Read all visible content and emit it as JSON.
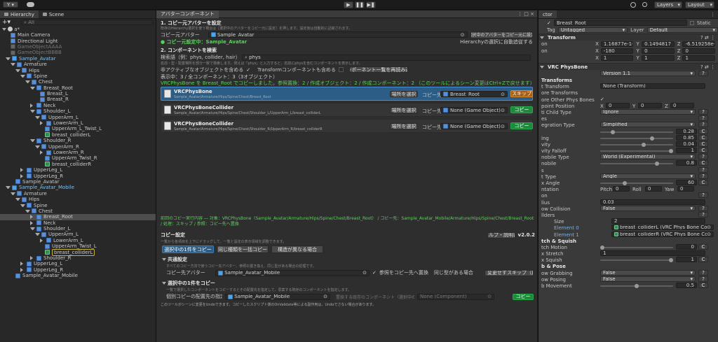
{
  "toolbar": {
    "account": "Y",
    "layers": "Layers",
    "layout": "Layout"
  },
  "hierarchy": {
    "tab": "Hierarchy",
    "scene_tab": "Scene",
    "search": "All",
    "scene": "a*",
    "items": [
      {
        "label": "Main Camera",
        "indent": 2,
        "icon": "cube",
        "exp": ""
      },
      {
        "label": "Directional Light",
        "indent": 2,
        "icon": "cube",
        "exp": ""
      },
      {
        "label": "GameObjectAAAA",
        "indent": 2,
        "icon": "grey",
        "exp": ""
      },
      {
        "label": "GameObjectBBBB",
        "indent": 2,
        "icon": "grey",
        "exp": ""
      },
      {
        "label": "Sample_Avatar",
        "indent": 2,
        "icon": "blue",
        "exp": "d"
      },
      {
        "label": "Armature",
        "indent": 3,
        "icon": "cube",
        "exp": "d"
      },
      {
        "label": "Hips",
        "indent": 4,
        "icon": "cube",
        "exp": "d"
      },
      {
        "label": "Spine",
        "indent": 5,
        "icon": "cube",
        "exp": "d"
      },
      {
        "label": "Chest",
        "indent": 6,
        "icon": "cube",
        "exp": "d"
      },
      {
        "label": "Breast_Root",
        "indent": 7,
        "icon": "cube",
        "exp": "d"
      },
      {
        "label": "Breast_L",
        "indent": 8,
        "icon": "cube",
        "exp": ""
      },
      {
        "label": "Breast_R",
        "indent": 8,
        "icon": "cube",
        "exp": ""
      },
      {
        "label": "Neck",
        "indent": 7,
        "icon": "cube",
        "exp": "r"
      },
      {
        "label": "Shoulder_L",
        "indent": 7,
        "icon": "cube",
        "exp": "d"
      },
      {
        "label": "UpperArm_L",
        "indent": 8,
        "icon": "cube",
        "exp": "d"
      },
      {
        "label": "LowerArm_L",
        "indent": 9,
        "icon": "cube",
        "exp": "r"
      },
      {
        "label": "UpperArm_L_Twist_L",
        "indent": 9,
        "icon": "cube",
        "exp": ""
      },
      {
        "label": "breast_colliderL",
        "indent": 9,
        "icon": "green",
        "exp": ""
      },
      {
        "label": "Shoulder_R",
        "indent": 7,
        "icon": "cube",
        "exp": "d"
      },
      {
        "label": "UpperArm_R",
        "indent": 8,
        "icon": "cube",
        "exp": "d"
      },
      {
        "label": "LowerArm_R",
        "indent": 9,
        "icon": "cube",
        "exp": "r"
      },
      {
        "label": "UpperArm_Twist_R",
        "indent": 9,
        "icon": "cube",
        "exp": ""
      },
      {
        "label": "breast_colliderR",
        "indent": 9,
        "icon": "green",
        "exp": ""
      },
      {
        "label": "UpperLeg_L",
        "indent": 5,
        "icon": "cube",
        "exp": "r"
      },
      {
        "label": "UpperLeg_R",
        "indent": 5,
        "icon": "cube",
        "exp": "r"
      },
      {
        "label": "Sample_Avatar",
        "indent": 3,
        "icon": "cube",
        "exp": ""
      },
      {
        "label": "Sample_Avatar_Mobile",
        "indent": 2,
        "icon": "blue",
        "exp": "d"
      },
      {
        "label": "Armature",
        "indent": 3,
        "icon": "cube",
        "exp": "d"
      },
      {
        "label": "Hips",
        "indent": 4,
        "icon": "cube",
        "exp": "d"
      },
      {
        "label": "Spine",
        "indent": 5,
        "icon": "cube",
        "exp": "d"
      },
      {
        "label": "Chest",
        "indent": 6,
        "icon": "cube",
        "exp": "d"
      },
      {
        "label": "Breast_Root",
        "indent": 7,
        "icon": "cube",
        "exp": "r",
        "sel": true
      },
      {
        "label": "Neck",
        "indent": 7,
        "icon": "cube",
        "exp": "r"
      },
      {
        "label": "Shoulder_L",
        "indent": 7,
        "icon": "cube",
        "exp": "d"
      },
      {
        "label": "UpperArm_L",
        "indent": 8,
        "icon": "cube",
        "exp": "d"
      },
      {
        "label": "LowerArm_L",
        "indent": 9,
        "icon": "cube",
        "exp": "r"
      },
      {
        "label": "UpperArm_Twist_L",
        "indent": 9,
        "icon": "cube",
        "exp": ""
      },
      {
        "label": "breast_colliderL",
        "indent": 9,
        "icon": "green",
        "exp": "",
        "hl": true
      },
      {
        "label": "Shoulder_R",
        "indent": 7,
        "icon": "cube",
        "exp": "r"
      },
      {
        "label": "UpperLeg_L",
        "indent": 5,
        "icon": "cube",
        "exp": "r"
      },
      {
        "label": "UpperLeg_R",
        "indent": 5,
        "icon": "cube",
        "exp": "r"
      },
      {
        "label": "Sample_Avatar_Mobile",
        "indent": 3,
        "icon": "cube",
        "exp": ""
      }
    ]
  },
  "window": {
    "title": "アバターコンポーネント",
    "s1_title": "1. コピー元アバターを設定",
    "s1_note": "既存のHierarchy選択を使う場合は［選択中のアバターをコピー元に設定］を押します。設定後は自動的に記録されます。",
    "src_label": "コピー元アバター",
    "src_value": "Sample_Avatar",
    "src_btn": "選択中のアバターをコピー元に設定",
    "src_status": "● コピー元設定中：Sample_Avatar",
    "src_auto": "Hierarchyの選択に自動追従する",
    "s2_title": "2. コンポーネントを検索",
    "search_label": "検索語（例：phys, collider, hair）",
    "search_value": "phys",
    "search_note": "名前・型・配置場所を部分一致で検索します。例えば「phys」と入力すると、名前にphysを含むコンポーネントを表示します。",
    "opt_inactive": "非アクティブなオブジェクトを含める",
    "opt_transform": "Transformコンポーネントも含める",
    "rescan_btn": "コンポーネント一覧を再読み込み",
    "count": "表示中：3 / 全コンポーネント：3（3オブジェクト）",
    "green_status": "VRCPhysBone を Breast_Root でコピーしました。参照置換：2 / 作成オブジェクト：2 / 作成コンポーネント：2 （このツールによるシーン変更はCtrl+Zで戻せます）",
    "comps": [
      {
        "name": "VRCPhysBone",
        "path": "Sample_Avatar/Armature/Hips/Spine/Chest/Breast_Root",
        "target": "Breast_Root",
        "action": "スキップ",
        "sel": true
      },
      {
        "name": "VRCPhysBoneCollider",
        "path": "Sample_Avatar/Armature/Hips/Spine/Chest/Shoulder_L/UpperArm_L/breast_colliderL",
        "target": "None (Game Object)",
        "action": "コピー"
      },
      {
        "name": "VRCPhysBoneCollider",
        "path": "Sample_Avatar/Armature/Hips/Spine/Chest/Shoulder_R/UpperArm_R/breast_colliderR",
        "target": "None (Game Object)",
        "action": "コピー"
      }
    ],
    "select_place": "場所を選択",
    "copy_dest": "コピー先",
    "bottom_status": "前回のコピー実行内容 ― 対象：VRCPhysBone（Sample_Avatar/Armature/Hips/Spine/Chest/Breast_Root） / コピー先：Sample_Avatar_Mobile/Armature/Hips/Spine/Chest/Breast_Root / 処理：スキップ / 参照：コピー先へ置換",
    "copy_settings": "コピー設定",
    "help_btn": "ヘルプ・説明書",
    "version": "v2.0.2",
    "copy_note": "一覧から各項目を上下にドラッグして、一覧と設定の表示領域を調整できます。",
    "tabs": [
      "選択中の1件をコピー",
      "同じ種類を一括コピー",
      "構造が異なる場合"
    ],
    "common": "共通設定",
    "common_note": "すべてのコピー方法で使うコピー先アバター、参照の置き換え、同じ型がある場合の処理です。",
    "dest_label": "コピー先アバター",
    "dest_value": "Sample_Avatar_Mobile",
    "ref_replace": "参照をコピー先へ置換",
    "same_type": "同じ型がある場合",
    "same_sel": "変更せずスキップ（推奨）",
    "single": "選択中の1件をコピー",
    "single_note": "一覧で選択したコンポーネントをコピーするとその配置先を指定して、思案する既存のコンポーネントを指定します。",
    "single_label": "個別コピーの配置先の指定先",
    "single_value": "Sample_Avatar_Mobile",
    "single_hint": "置換する既存のコンポーネント（選択中の1件）",
    "single_none": "None (Component)",
    "copy_btn": "コピー",
    "footer": "このツールがシーンに変更をUndoできます。コピーしたスクリプト側のOnValidate等による副作用は、Undoでさない場合があります。"
  },
  "inspector": {
    "tab": "ctor",
    "name": "Breast_Root",
    "static": "Static",
    "tag_label": "Tag",
    "tag": "Untagged",
    "layer_label": "Layer",
    "layer": "Default",
    "transform": "Transform",
    "pos": [
      "1.16877e-16",
      "0.1494817",
      "-6.519258e-0"
    ],
    "rot": [
      "-180",
      "0",
      "0"
    ],
    "scl": [
      "1",
      "1",
      "1"
    ],
    "row_labels": [
      "on",
      "on",
      ""
    ],
    "axes": [
      "X",
      "Y",
      "Z"
    ],
    "comp": "VRC PhysBone",
    "version": "Version 1.1",
    "rows": [
      {
        "label": "Transforms",
        "t": "hdr"
      },
      {
        "label": "t Transform",
        "t": "field",
        "v": "None (Transform)"
      },
      {
        "label": "ore Transforms",
        "t": "none"
      },
      {
        "label": "ore Other Phys Bones",
        "t": "check"
      },
      {
        "label": "point Position",
        "t": "xyz",
        "v": [
          "0",
          "0",
          "0"
        ]
      },
      {
        "label": "ti Child Type",
        "t": "dropdown",
        "v": "Ignore"
      },
      {
        "label": "es",
        "t": "help"
      },
      {
        "label": "egration Type",
        "t": "dropdown",
        "v": "Simplified"
      },
      {
        "label": "",
        "t": "slider",
        "v": "0.28",
        "p": 0.15
      },
      {
        "label": "ing",
        "t": "slider",
        "v": "0.85",
        "p": 0.72
      },
      {
        "label": "vity",
        "t": "slider",
        "v": "0.04",
        "p": 0.6
      },
      {
        "label": "vity Falloff",
        "t": "slider",
        "v": "1",
        "p": 1.0
      },
      {
        "label": "nobile Type",
        "t": "dropdown",
        "v": "World (Experimental)"
      },
      {
        "label": "nobile",
        "t": "slider",
        "v": "0.8",
        "p": 0.8
      },
      {
        "label": "s",
        "t": "help"
      },
      {
        "label": "t Type",
        "t": "dropdown",
        "v": "Angle"
      },
      {
        "label": "x Angle",
        "t": "slider",
        "v": "60",
        "p": 0.33
      },
      {
        "label": "ntation",
        "t": "pry",
        "v": [
          "0",
          "0",
          "0"
        ]
      },
      {
        "label": "on",
        "t": "help"
      },
      {
        "label": "lius",
        "t": "field",
        "v": "0.03"
      },
      {
        "label": "ow Collision",
        "t": "dropdown",
        "v": "False"
      },
      {
        "label": "llders",
        "t": "help"
      },
      {
        "label": "Size",
        "t": "size",
        "v": "2"
      },
      {
        "label": "Element 0",
        "t": "obj",
        "v": "breast_colliderL (VRC Phys Bone Collider)"
      },
      {
        "label": "Element 1",
        "t": "obj",
        "v": "breast_colliderR (VRC Phys Bone Collider)"
      },
      {
        "label": "tch & Squish",
        "t": "hdr"
      },
      {
        "label": "tch Motion",
        "t": "slider",
        "v": "0",
        "p": 0.0
      },
      {
        "label": "x Stretch",
        "t": "field",
        "v": "1"
      },
      {
        "label": "x Squish",
        "t": "slider",
        "v": "1",
        "p": 1.0
      },
      {
        "label": "b & Pose",
        "t": "hdr"
      },
      {
        "label": "ow Grabbing",
        "t": "dropdown",
        "v": "False"
      },
      {
        "label": "ow Posing",
        "t": "dropdown",
        "v": "False"
      },
      {
        "label": "b Movement",
        "t": "slider",
        "v": "0.5",
        "p": 0.5
      }
    ],
    "pitch": "Pitch",
    "roll": "Roll",
    "yaw": "Yaw",
    "c": "C",
    "q": "?"
  },
  "colors": {
    "accent": "#2c5d87",
    "select": "#2c5d87",
    "green_btn": "#1e8a3c",
    "orange_btn": "#a85f13",
    "status_green": "#5ad25a"
  }
}
